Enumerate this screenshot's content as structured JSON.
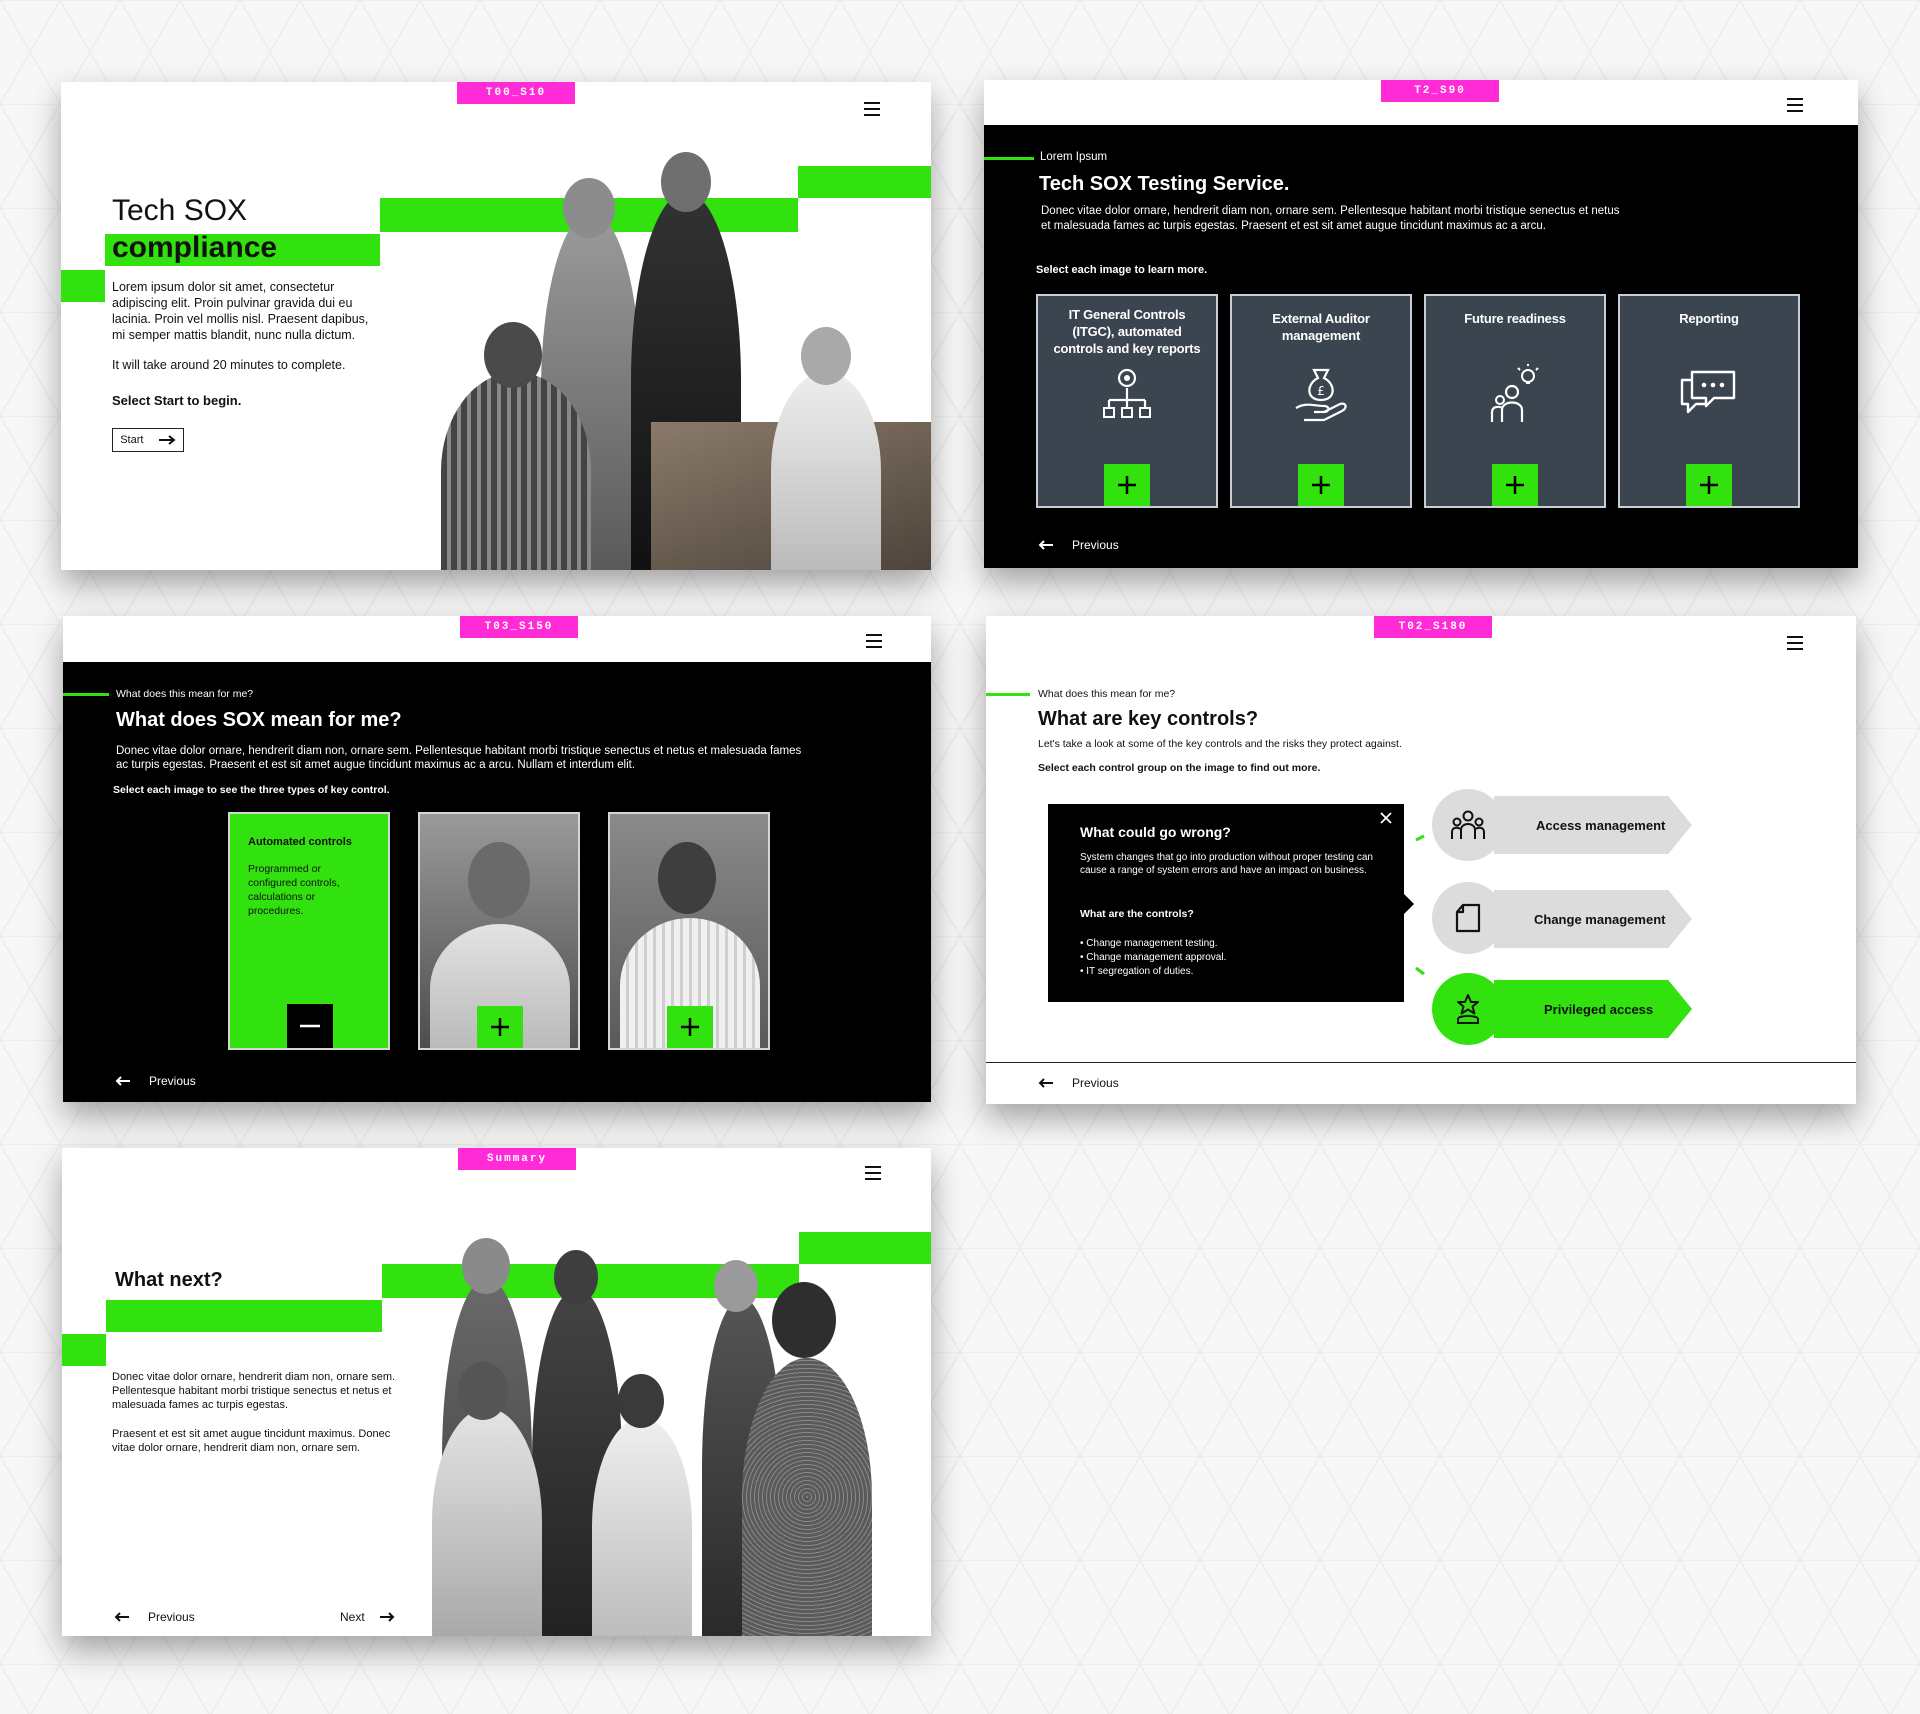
{
  "slide1": {
    "tag": "T00_S10",
    "title_line1": "Tech SOX",
    "title_line2": "compliance",
    "body": "Lorem ipsum dolor sit amet, consectetur adipiscing elit. Proin pulvinar gravida dui eu lacinia. Proin vel mollis nisl. Praesent dapibus, mi semper mattis blandit, nunc nulla dictum.",
    "duration": "It will take around 20 minutes to complete.",
    "instruction": "Select Start to begin.",
    "start_label": "Start"
  },
  "slide2": {
    "tag": "T2_S90",
    "eyebrow": "Lorem Ipsum",
    "title": "Tech SOX Testing Service.",
    "body": "Donec vitae dolor ornare, hendrerit diam non, ornare sem. Pellentesque habitant morbi tristique senectus et netus et malesuada fames ac turpis egestas. Praesent et est sit amet augue tincidunt maximus ac a arcu.",
    "instruction": "Select each image to learn more.",
    "cards": [
      {
        "title": "IT General Controls (ITGC), automated controls and key reports",
        "icon": "org-gear-icon"
      },
      {
        "title": "External Auditor management",
        "icon": "money-bag-hand-icon"
      },
      {
        "title": "Future readiness",
        "icon": "person-idea-icon"
      },
      {
        "title": "Reporting",
        "icon": "chat-bubbles-icon"
      }
    ],
    "previous_label": "Previous"
  },
  "slide3": {
    "tag": "T03_S150",
    "eyebrow": "What does this mean for me?",
    "title": "What does SOX mean for me?",
    "body": "Donec vitae dolor ornare, hendrerit diam non, ornare sem. Pellentesque habitant morbi tristique senectus et netus et malesuada fames ac turpis egestas. Praesent et est sit amet augue tincidunt maximus ac a arcu. Nullam et interdum elit.",
    "instruction": "Select each image to see the three types of key control.",
    "open_card": {
      "title": "Automated controls",
      "body": "Programmed or configured controls, calculations or procedures."
    },
    "previous_label": "Previous"
  },
  "slide4": {
    "tag": "T02_S180",
    "eyebrow": "What does this mean for me?",
    "title": "What are key controls?",
    "subtitle": "Let's take a look at some of the key controls and the risks they protect against.",
    "instruction": "Select each control group on the image to find out more.",
    "popup": {
      "heading": "What could go wrong?",
      "body": "System changes that go into production without proper testing can cause a range of system errors and have an impact on business.",
      "subheading": "What are the controls?",
      "bullets": [
        "• Change management testing.",
        "• Change management approval.",
        "• IT segregation of duties."
      ]
    },
    "controls": [
      {
        "label": "Access management",
        "icon": "people-group-icon",
        "active": false
      },
      {
        "label": "Change management",
        "icon": "document-icon",
        "active": false
      },
      {
        "label": "Privileged access",
        "icon": "user-star-icon",
        "active": true
      }
    ],
    "previous_label": "Previous"
  },
  "slide5": {
    "tag": "Summary",
    "title": "What next?",
    "body1": "Donec vitae dolor ornare, hendrerit diam non, ornare sem. Pellentesque habitant morbi tristique senectus et netus et malesuada fames ac turpis egestas.",
    "body2": "Praesent et est sit amet augue tincidunt maximus. Donec vitae dolor ornare, hendrerit diam non, ornare sem.",
    "previous_label": "Previous",
    "next_label": "Next"
  },
  "colors": {
    "accent": "#32e20f",
    "tag": "#ff2bd6",
    "dark": "#000000",
    "card": "#3a4550"
  }
}
